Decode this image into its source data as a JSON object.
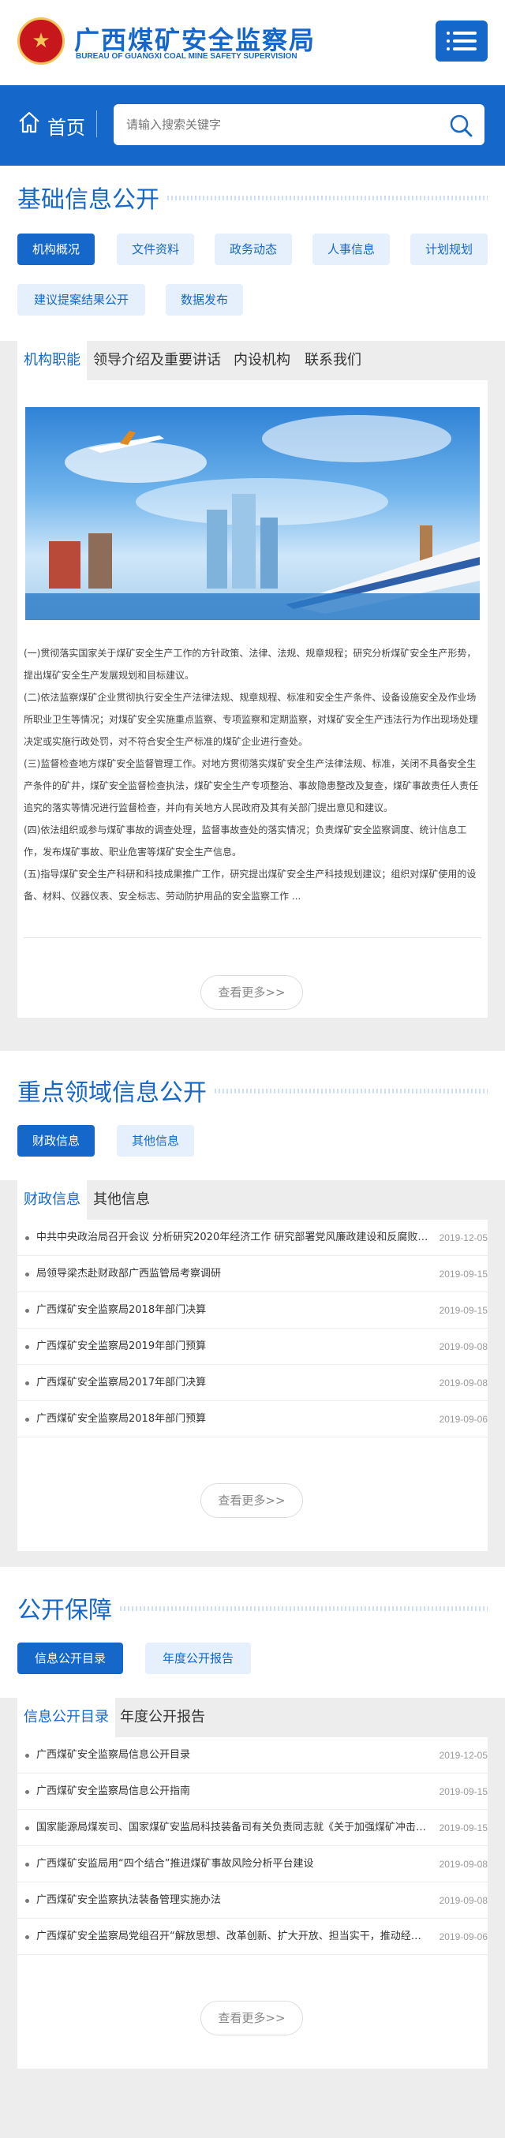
{
  "header": {
    "title": "广西煤矿安全监察局",
    "subtitle": "BUREAU OF GUANGXI COAL MINE SAFETY SUPERVISION"
  },
  "nav": {
    "home_label": "首页"
  },
  "search": {
    "placeholder": "请输入搜索关键字"
  },
  "section1": {
    "title": "基础信息公开",
    "pills": [
      "机构概况",
      "文件资料",
      "政务动态",
      "人事信息",
      "计划规划",
      "建议提案结果公开",
      "数据发布"
    ],
    "tabs": [
      "机构职能",
      "领导介绍及重要讲话",
      "内设机构",
      "联系我们"
    ],
    "paragraphs": [
      "(一)贯彻落实国家关于煤矿安全生产工作的方针政策、法律、法规、规章规程；研究分析煤矿安全生产形势，提出煤矿安全生产发展规划和目标建议。",
      "(二)依法监察煤矿企业贯彻执行安全生产法律法规、规章规程、标准和安全生产条件、设备设施安全及作业场所职业卫生等情况；对煤矿安全实施重点监察、专项监察和定期监察，对煤矿安全生产违法行为作出现场处理决定或实施行政处罚，对不符合安全生产标准的煤矿企业进行查处。",
      "(三)监督检查地方煤矿安全监督管理工作。对地方贯彻落实煤矿安全生产法律法规、标准，关闭不具备安全生产条件的矿井，煤矿安全监督检查执法，煤矿安全生产专项整治、事故隐患整改及复查，煤矿事故责任人责任追究的落实等情况进行监督检查，并向有关地方人民政府及其有关部门提出意见和建议。",
      "(四)依法组织或参与煤矿事故的调查处理，监督事故查处的落实情况；负责煤矿安全监察调度、统计信息工作，发布煤矿事故、职业危害等煤矿安全生产信息。",
      "(五)指导煤矿安全生产科研和科技成果推广工作，研究提出煤矿安全生产科技规划建议；组织对煤矿使用的设备、材料、仪器仪表、安全标志、劳动防护用品的安全监察工作 ..."
    ],
    "more": "查看更多>>"
  },
  "section2": {
    "title": "重点领域信息公开",
    "pills": [
      "财政信息",
      "其他信息"
    ],
    "tabs": [
      "财政信息",
      "其他信息"
    ],
    "news": [
      {
        "title": "中共中央政治局召开会议 分析研究2020年经济工作 研究部署党风廉政建设和反腐败工作",
        "date": "2019-12-05"
      },
      {
        "title": "局领导梁杰赴财政部广西监管局考察调研",
        "date": "2019-09-15"
      },
      {
        "title": "广西煤矿安全监察局2018年部门决算",
        "date": "2019-09-15"
      },
      {
        "title": "广西煤矿安全监察局2019年部门预算",
        "date": "2019-09-08"
      },
      {
        "title": "广西煤矿安全监察局2017年部门决算",
        "date": "2019-09-08"
      },
      {
        "title": "广西煤矿安全监察局2018年部门预算",
        "date": "2019-09-06"
      }
    ],
    "more": "查看更多>>"
  },
  "section3": {
    "title": "公开保障",
    "pills": [
      "信息公开目录",
      "年度公开报告"
    ],
    "tabs": [
      "信息公开目录",
      "年度公开报告"
    ],
    "news": [
      {
        "title": "广西煤矿安全监察局信息公开目录",
        "date": "2019-12-05"
      },
      {
        "title": "广西煤矿安全监察局信息公开指南",
        "date": "2019-09-15"
      },
      {
        "title": "国家能源局煤炭司、国家煤矿安监局科技装备司有关负责同志就《关于加强煤矿冲击地压源头治理的通知》答记者问",
        "date": "2019-09-15"
      },
      {
        "title": "广西煤矿安监局用“四个结合”推进煤矿事故风险分析平台建设",
        "date": "2019-09-08"
      },
      {
        "title": "广西煤矿安全监察执法装备管理实施办法",
        "date": "2019-09-08"
      },
      {
        "title": "广西煤矿安全监察局党组召开“解放思想、改革创新、扩大开放、担当实干，推动经济高质量发展”大讨论活动动员会",
        "date": "2019-09-06"
      }
    ],
    "more": "查看更多>>"
  },
  "colors": {
    "primary": "#1567c9",
    "pill_bg": "#e6f0fc",
    "band": "#ededed"
  }
}
